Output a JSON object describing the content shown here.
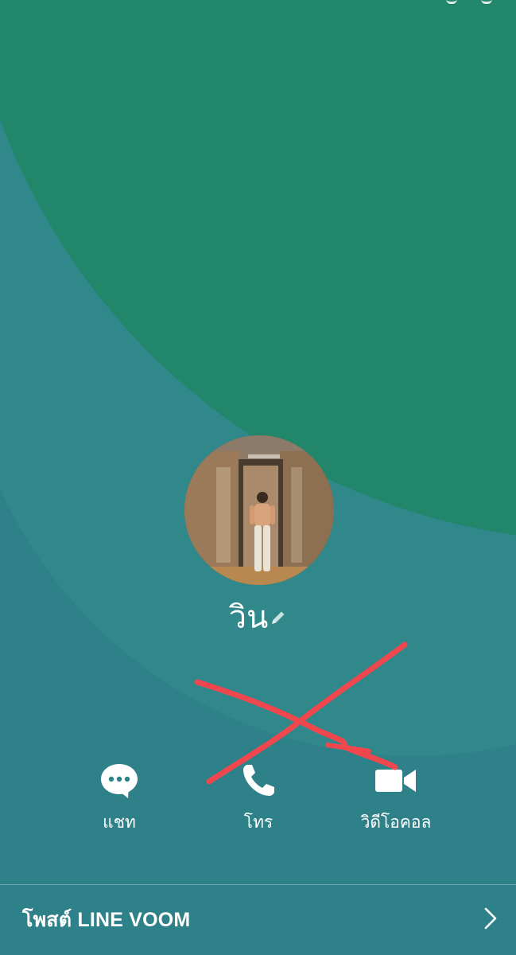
{
  "profile": {
    "name": "วิน"
  },
  "actions": [
    {
      "label": "แชท",
      "icon": "chat-bubble-icon"
    },
    {
      "label": "โทร",
      "icon": "phone-icon"
    },
    {
      "label": "วิดีโอคอล",
      "icon": "video-camera-icon"
    }
  ],
  "voom": {
    "label": "โพสต์ LINE VOOM",
    "icon": "chevron-right-icon"
  },
  "colors": {
    "background_top": "#21866a",
    "background_bottom": "#2e8189",
    "ring": "#31888a",
    "annotation": "#f0474f",
    "text": "#ffffff"
  }
}
